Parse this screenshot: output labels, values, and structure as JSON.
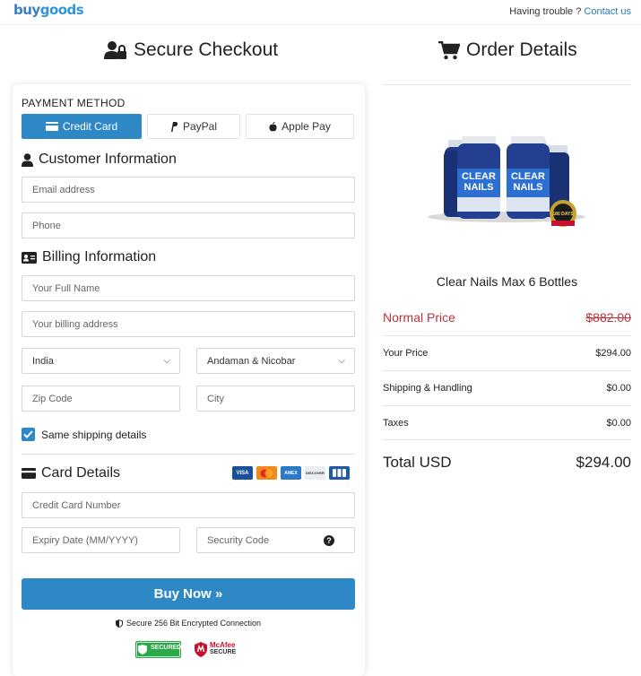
{
  "header": {
    "logo_part1": "buy",
    "logo_part2": "goods",
    "trouble_text": "Having trouble ?",
    "contact_link": "Contact us"
  },
  "checkout": {
    "title": "Secure Checkout",
    "payment_method_label": "PAYMENT METHOD",
    "tabs": [
      {
        "label": "Credit Card",
        "active": true
      },
      {
        "label": "PayPal",
        "active": false
      },
      {
        "label": "Apple Pay",
        "active": false
      }
    ],
    "customer_heading": "Customer Information",
    "email_placeholder": "Email address",
    "phone_placeholder": "Phone",
    "billing_heading": "Billing Information",
    "name_placeholder": "Your Full Name",
    "address_placeholder": "Your billing address",
    "country_value": "India",
    "state_value": "Andaman & Nicobar",
    "zip_placeholder": "Zip Code",
    "city_placeholder": "City",
    "same_shipping_label": "Same shipping details",
    "same_shipping_checked": true,
    "card_heading": "Card Details",
    "card_brands": [
      "VISA",
      "MC",
      "AMEX",
      "DISCOVER",
      "JCB"
    ],
    "card_number_placeholder": "Credit Card Number",
    "expiry_placeholder": "Expiry Date (MM/YYYY)",
    "security_placeholder": "Security Code",
    "buy_button": "Buy Now »",
    "secure_text": "Secure 256 Bit Encrypted Connection",
    "badge_secured": "SECURED",
    "badge_mcafee_1": "McAfee",
    "badge_mcafee_2": "SECURE"
  },
  "order": {
    "title": "Order Details",
    "product_name": "Clear Nails Max 6 Bottles",
    "bottle_label_1": "CLEAR",
    "bottle_label_2": "NAILS",
    "seal_text": "180 DAYS",
    "normal_price_label": "Normal Price",
    "normal_price_value": "$882.00",
    "your_price_label": "Your Price",
    "your_price_value": "$294.00",
    "shipping_label": "Shipping & Handling",
    "shipping_value": "$0.00",
    "taxes_label": "Taxes",
    "taxes_value": "$0.00",
    "total_label": "Total USD",
    "total_value": "$294.00"
  },
  "colors": {
    "accent": "#2f88c6",
    "strike": "#c0303a"
  }
}
